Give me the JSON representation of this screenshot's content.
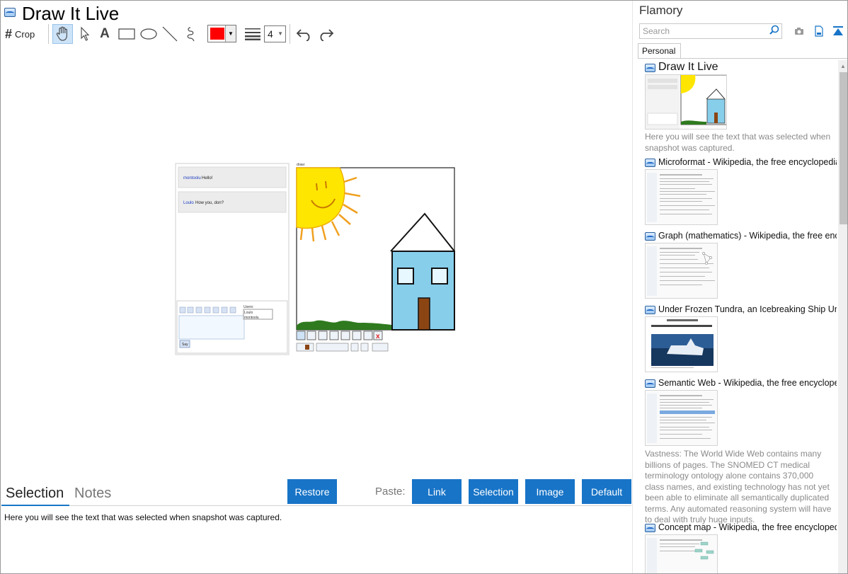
{
  "window": {
    "title": "Draw It Live"
  },
  "toolbar": {
    "crop_label": "Crop",
    "tools": [
      "hand-icon",
      "pointer-icon",
      "text-icon",
      "rectangle-icon",
      "ellipse-icon",
      "line-icon",
      "freehand-icon"
    ],
    "selected_tool": "hand-icon",
    "stroke_color": "#ff0000",
    "line_width": "4"
  },
  "snapshot": {
    "chat_messages": [
      {
        "user": "montoolu",
        "text": "Hello!"
      },
      {
        "user": "Loulo",
        "text": "How you, don?"
      }
    ],
    "users_label": "Users:",
    "users": [
      "Loulo",
      "montoolu"
    ],
    "say_label": "Say",
    "canvas_label": "draw:",
    "canvas_colors": {
      "sky": "#ffffff",
      "house": "#87ceeb",
      "door": "#8b4513",
      "sun": "#ffe600",
      "sun_rays": "#f0a020",
      "grass": "#2f7a1f"
    }
  },
  "bottom": {
    "tabs": [
      "Selection",
      "Notes"
    ],
    "active_tab": "Selection",
    "restore_label": "Restore",
    "paste_label": "Paste:",
    "paste_buttons": [
      "Link",
      "Selection",
      "Image",
      "Default"
    ],
    "selection_text": "Here you will see the text that was selected when snapshot was captured."
  },
  "sidebar": {
    "brand": "Flamory",
    "search_placeholder": "Search",
    "tab": "Personal",
    "items": [
      {
        "title": "Draw It Live",
        "desc": "Here you will see the text that was selected when snapshot was captured."
      },
      {
        "title": "Microformat - Wikipedia, the free encyclopedia",
        "desc": ""
      },
      {
        "title": "Graph (mathematics) - Wikipedia, the free ency",
        "desc": ""
      },
      {
        "title": "Under Frozen Tundra, an Icebreaking Ship Unco",
        "desc": ""
      },
      {
        "title": "Semantic Web - Wikipedia, the free encycloped",
        "desc": "Vastness: The World Wide Web contains many billions of pages. The SNOMED CT medical terminology ontology alone contains 370,000 class names, and existing technology has not yet been able to eliminate all semantically duplicated terms. Any automated reasoning system will have to deal with truly huge inputs."
      },
      {
        "title": "Concept map - Wikipedia, the free encyclopedia",
        "desc": ""
      }
    ]
  },
  "colors": {
    "accent": "#1874c7"
  }
}
